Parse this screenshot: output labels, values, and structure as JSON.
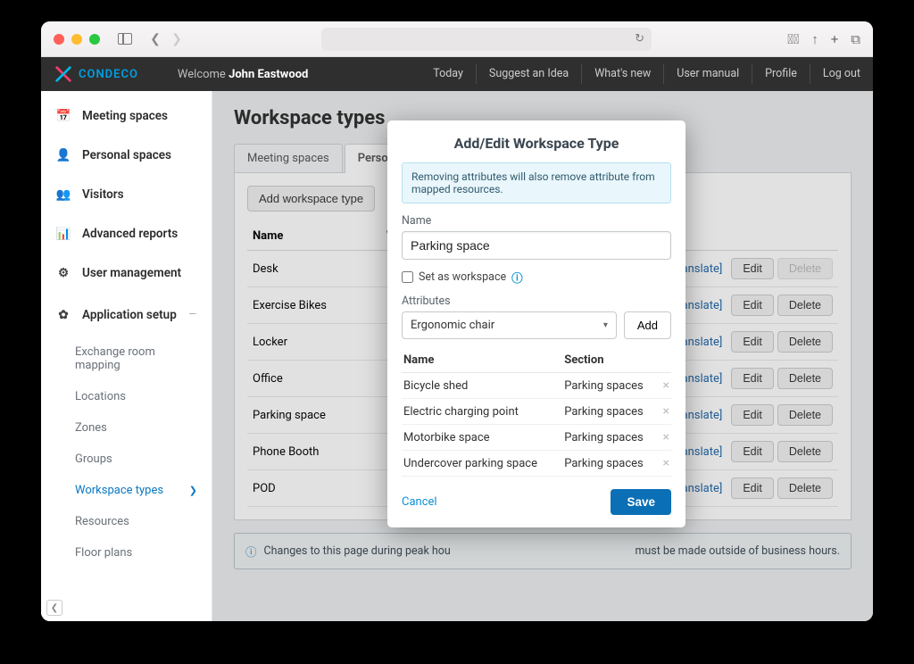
{
  "header": {
    "brand": "CONDECO",
    "welcome_prefix": "Welcome ",
    "user_name": "John Eastwood",
    "links": [
      "Today",
      "Suggest an Idea",
      "What's new",
      "User manual",
      "Profile",
      "Log out"
    ]
  },
  "sidebar": {
    "items": [
      {
        "label": "Meeting spaces",
        "icon": "meeting"
      },
      {
        "label": "Personal spaces",
        "icon": "person"
      },
      {
        "label": "Visitors",
        "icon": "visitors"
      },
      {
        "label": "Advanced reports",
        "icon": "chart"
      },
      {
        "label": "User management",
        "icon": "users"
      },
      {
        "label": "Application setup",
        "icon": "gear",
        "expanded": true
      }
    ],
    "sub_items": [
      {
        "label": "Exchange room mapping"
      },
      {
        "label": "Locations"
      },
      {
        "label": "Zones"
      },
      {
        "label": "Groups"
      },
      {
        "label": "Workspace types",
        "active": true
      },
      {
        "label": "Resources"
      },
      {
        "label": "Floor plans"
      }
    ]
  },
  "page": {
    "title": "Workspace types",
    "tabs": [
      "Meeting spaces",
      "Personal spaces"
    ],
    "add_btn": "Add workspace type",
    "col_name": "Name",
    "col_workspace": "Workspace",
    "rows": [
      {
        "name": "Desk",
        "ws": true,
        "translate": "[Translate]",
        "edit": "Edit",
        "delete": "Delete",
        "del_disabled": true
      },
      {
        "name": "Exercise Bikes",
        "ws": true,
        "translate": "[Translate]",
        "edit": "Edit",
        "delete": "Delete"
      },
      {
        "name": "Locker",
        "ws": false,
        "translate": "[Translate]",
        "edit": "Edit",
        "delete": "Delete"
      },
      {
        "name": "Office",
        "ws": true,
        "translate": "[Translate]",
        "edit": "Edit",
        "delete": "Delete"
      },
      {
        "name": "Parking space",
        "ws": false,
        "translate": "[Translate]",
        "edit": "Edit",
        "delete": "Delete"
      },
      {
        "name": "Phone Booth",
        "ws": true,
        "translate": "[Translate]",
        "edit": "Edit",
        "delete": "Delete"
      },
      {
        "name": "POD",
        "ws": true,
        "translate": "[Translate]",
        "edit": "Edit",
        "delete": "Delete"
      }
    ],
    "banner_pre": "Changes to this page during peak hou",
    "banner_post": "must be made outside of business hours."
  },
  "modal": {
    "title": "Add/Edit Workspace Type",
    "alert": "Removing attributes will also remove attribute from mapped resources.",
    "name_label": "Name",
    "name_value": "Parking space",
    "set_as_workspace": "Set as workspace",
    "attributes_label": "Attributes",
    "select_value": "Ergonomic chair",
    "add_label": "Add",
    "col_name": "Name",
    "col_section": "Section",
    "attrs": [
      {
        "name": "Bicycle shed",
        "section": "Parking spaces"
      },
      {
        "name": "Electric charging point",
        "section": "Parking spaces"
      },
      {
        "name": "Motorbike space",
        "section": "Parking spaces"
      },
      {
        "name": "Undercover parking space",
        "section": "Parking spaces"
      }
    ],
    "cancel": "Cancel",
    "save": "Save"
  }
}
